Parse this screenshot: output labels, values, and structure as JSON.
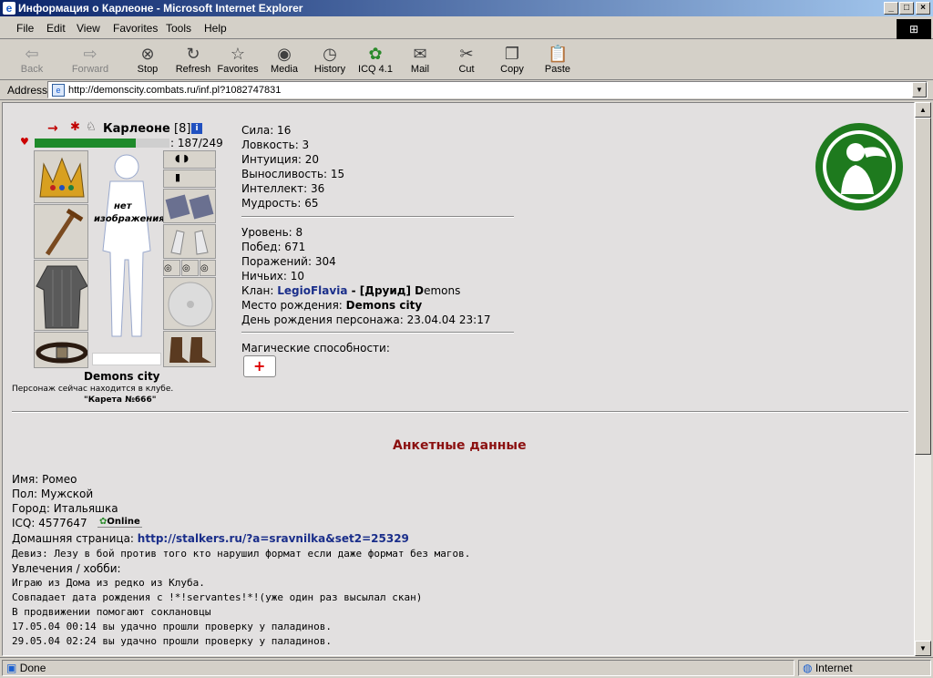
{
  "window": {
    "title": "Информация о Карлеоне - Microsoft Internet Explorer",
    "min": "_",
    "max": "□",
    "close": "×"
  },
  "menu": {
    "file": "File",
    "edit": "Edit",
    "view": "View",
    "favorites": "Favorites",
    "tools": "Tools",
    "help": "Help"
  },
  "toolbar": {
    "back": "Back",
    "forward": "Forward",
    "stop": "Stop",
    "refresh": "Refresh",
    "favorites": "Favorites",
    "media": "Media",
    "history": "History",
    "icq": "ICQ 4.1",
    "mail": "Mail",
    "cut": "Cut",
    "copy": "Copy",
    "paste": "Paste"
  },
  "address": {
    "label": "Address",
    "url": "http://demonscity.combats.ru/inf.pl?1082747831"
  },
  "character": {
    "name": "Карлеоне",
    "level": "[8]",
    "hp": ": 187/249",
    "hp_fraction": 0.75,
    "no_image_1": "нет",
    "no_image_2": "изображения",
    "city": "Demons city",
    "location_note": "Персонаж сейчас находится в клубе.",
    "location_place": "\"Карета №666\""
  },
  "stats": {
    "strength": "Сила: 16",
    "agility": "Ловкость: 3",
    "intuition": "Интуиция: 20",
    "endurance": "Выносливость: 15",
    "intellect": "Интеллект: 36",
    "wisdom": "Мудрость: 65"
  },
  "record": {
    "level": "Уровень: 8",
    "wins": "Побед: 671",
    "losses": "Поражений: 304",
    "draws": "Ничьих: 10",
    "clan_label": "Клан: ",
    "clan_name": "LegioFlavia",
    "clan_rank": " - [Друид] ",
    "clan_rank_bold": "D",
    "clan_rank_rest": "emons",
    "birthplace_label": "Место рождения: ",
    "birthplace_value": "Demons city",
    "birthday": "День рождения персонажа: 23.04.04 23:17"
  },
  "magic": {
    "label": "Магические способности:"
  },
  "profile": {
    "heading": "Анкетные данные",
    "name": "Имя: Ромео",
    "gender": "Пол: Мужской",
    "city": "Город: Итальяшка",
    "icq": "ICQ: 4577647",
    "icq_status": "Online",
    "homepage_label": "Домашняя страница: ",
    "homepage_url": "http://stalkers.ru/?a=sravnilka&set2=25329",
    "motto": "Девиз: Лезу в бой против того кто нарушил формат если даже формат без магов.",
    "hobbies_label": "Увлечения / хобби:",
    "lines": [
      "Играю из Дома из редко из Клуба.",
      "Совпадает дата рождения с !*!servantes!*!(уже один раз высылал скан)",
      "В продвижении помогают соклановцы",
      "17.05.04 00:14 вы удачно прошли проверку у паладинов.",
      "29.05.04 02:24 вы удачно прошли проверку у паладинов."
    ]
  },
  "status": {
    "text": "Done",
    "zone": "Internet"
  }
}
